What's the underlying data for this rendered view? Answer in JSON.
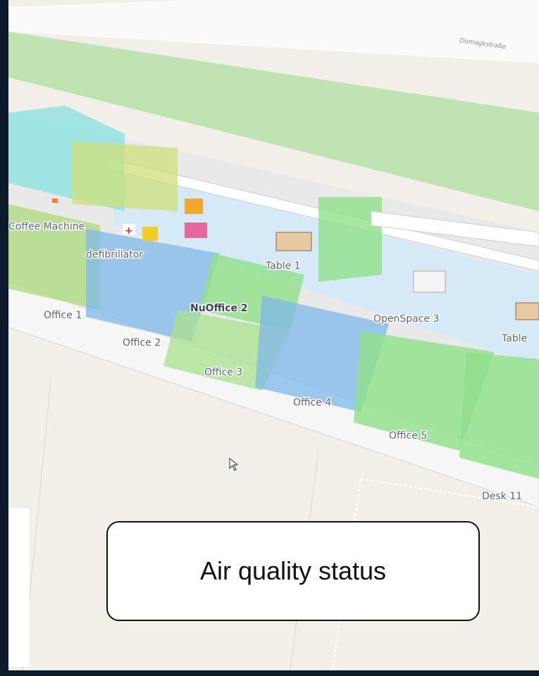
{
  "map": {
    "street_name": "Domagkstraße",
    "labels": {
      "coffee_machine": "Coffee Machine",
      "defibrillator": "defibrillator",
      "table_1": "Table 1",
      "nuoffice_2": "NuOffice 2",
      "openspace_3": "OpenSpace 3",
      "table_partial": "Table",
      "office_1": "Office 1",
      "office_2": "Office 2",
      "office_3": "Office 3",
      "office_4": "Office 4",
      "office_5": "Office 5",
      "desk_11": "Desk 11"
    },
    "status_colors": {
      "good": "#8ee08a",
      "moderate": "#cfe07a",
      "fair": "#7fb8ea",
      "cyan": "#7fe0e0"
    }
  },
  "callout": {
    "text": "Air quality status"
  }
}
